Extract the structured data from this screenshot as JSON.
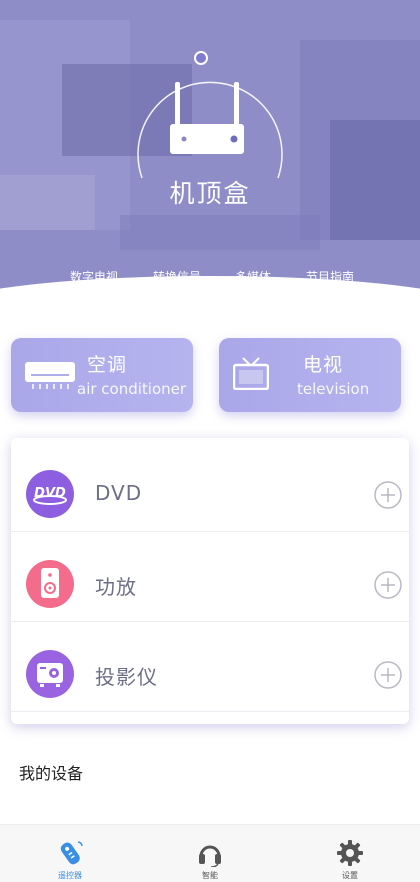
{
  "hero": {
    "title": "机顶盒",
    "nav": [
      "数字电视",
      "转换信号",
      "多媒体",
      "节目指南"
    ],
    "icon": "router-icon"
  },
  "quick": [
    {
      "title": "空调",
      "subtitle": "air conditioner",
      "icon": "air-conditioner-icon"
    },
    {
      "title": "电视",
      "subtitle": "television",
      "icon": "tv-icon"
    }
  ],
  "devices": [
    {
      "label": "DVD",
      "icon": "dvd-icon",
      "icon_color": "#8d5fe0"
    },
    {
      "label": "功放",
      "icon": "speaker-icon",
      "icon_color": "#f36c8b"
    },
    {
      "label": "投影仪",
      "icon": "projector-icon",
      "icon_color": "#9a63e2"
    }
  ],
  "section_title": "我的设备",
  "tabs": [
    {
      "label": "遥控器",
      "icon": "remote-icon",
      "active": true
    },
    {
      "label": "智能",
      "icon": "headset-icon",
      "active": false
    },
    {
      "label": "设置",
      "icon": "gear-icon",
      "active": false
    }
  ],
  "colors": {
    "accent": "#3a8fe5",
    "hero_purple": "#8a87c4",
    "card_purple": "#aeacec",
    "text_gray": "#6d6f86"
  }
}
